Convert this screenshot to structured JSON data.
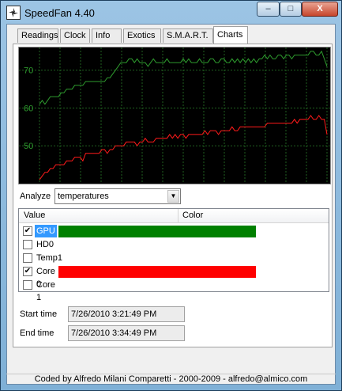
{
  "window": {
    "title": "SpeedFan 4.40",
    "min_label": "–",
    "max_label": "□",
    "close_label": "X"
  },
  "tabs": [
    {
      "label": "Readings"
    },
    {
      "label": "Clock"
    },
    {
      "label": "Info"
    },
    {
      "label": "Exotics"
    },
    {
      "label": "S.M.A.R.T."
    },
    {
      "label": "Charts"
    }
  ],
  "active_tab": "Charts",
  "chart_data": {
    "type": "line",
    "background": "#000000",
    "grid": true,
    "grid_color": "#1f5f1f",
    "ylim": [
      40,
      76
    ],
    "ytick_labels": [
      "70",
      "60",
      "50"
    ],
    "yticks": [
      70,
      60,
      50
    ],
    "series": [
      {
        "name": "GPU",
        "color": "#2e9b2e",
        "values": [
          61,
          62,
          61,
          62,
          63,
          63,
          63,
          63,
          64,
          64,
          65,
          65,
          65,
          66,
          66,
          66,
          66,
          67,
          67,
          67,
          67,
          67,
          67,
          67,
          67,
          68,
          68,
          69,
          70,
          71,
          72,
          72,
          72,
          73,
          73,
          72,
          73,
          72,
          72,
          72,
          71,
          72,
          73,
          72,
          72,
          72,
          72,
          73,
          72,
          72,
          72,
          72,
          72,
          73,
          72,
          73,
          72,
          72,
          72,
          73,
          72,
          72,
          72,
          73,
          73,
          72,
          72,
          73,
          73,
          72,
          72,
          73,
          72,
          73,
          72,
          73,
          72,
          73,
          72,
          73,
          72,
          73,
          73,
          74,
          73,
          74,
          73,
          73,
          74,
          74,
          73,
          74,
          74,
          73,
          74,
          74,
          74,
          74,
          74,
          74,
          75,
          75,
          74,
          74,
          75,
          73,
          71
        ]
      },
      {
        "name": "Core 0",
        "color": "#ff1a1a",
        "values": [
          41,
          42,
          43,
          43,
          44,
          44,
          45,
          45,
          45,
          45,
          46,
          46,
          46,
          47,
          47,
          47,
          46,
          48,
          48,
          48,
          48,
          48,
          48,
          49,
          49,
          48,
          49,
          49,
          50,
          50,
          50,
          50,
          51,
          51,
          51,
          51,
          50,
          51,
          51,
          52,
          51,
          51,
          51,
          52,
          52,
          52,
          52,
          52,
          53,
          52,
          53,
          52,
          53,
          53,
          52,
          53,
          53,
          53,
          53,
          53,
          53,
          54,
          53,
          54,
          54,
          54,
          53,
          54,
          54,
          54,
          54,
          55,
          54,
          54,
          55,
          55,
          55,
          55,
          55,
          55,
          55,
          55,
          55,
          55,
          56,
          56,
          56,
          56,
          56,
          56,
          56,
          56,
          56,
          56,
          57,
          56,
          57,
          57,
          57,
          57,
          58,
          57,
          57,
          58,
          57,
          57,
          53
        ]
      }
    ]
  },
  "analyze": {
    "label": "Analyze",
    "selected": "temperatures",
    "arrow": "▼"
  },
  "list": {
    "col_value": "Value",
    "col_color": "Color",
    "items": [
      {
        "label": "GPU",
        "checked": true,
        "selected": true,
        "color": "#008000",
        "check_mark": "✔"
      },
      {
        "label": "HD0",
        "checked": false,
        "selected": false,
        "color": "",
        "check_mark": ""
      },
      {
        "label": "Temp1",
        "checked": false,
        "selected": false,
        "color": "",
        "check_mark": ""
      },
      {
        "label": "Core 0",
        "checked": true,
        "selected": false,
        "color": "#ff0000",
        "check_mark": "✔"
      },
      {
        "label": "Core 1",
        "checked": false,
        "selected": false,
        "color": "",
        "check_mark": ""
      }
    ]
  },
  "start_time": {
    "label": "Start time",
    "value": "7/26/2010 3:21:49 PM"
  },
  "end_time": {
    "label": "End time",
    "value": "7/26/2010 3:34:49 PM"
  },
  "status": "Coded by Alfredo Milani Comparetti - 2000-2009 - alfredo@almico.com"
}
